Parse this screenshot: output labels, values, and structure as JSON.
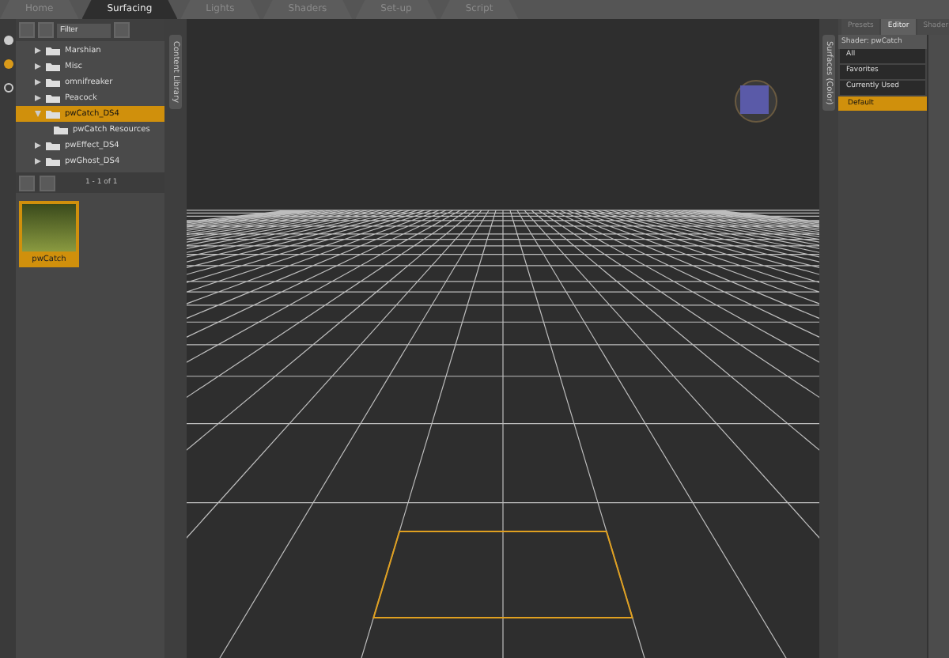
{
  "top_tabs": [
    {
      "label": "Home",
      "selected": false
    },
    {
      "label": "Surfacing",
      "selected": true
    },
    {
      "label": "Lights",
      "selected": false
    },
    {
      "label": "Shaders",
      "selected": false
    },
    {
      "label": "Set-up",
      "selected": false
    },
    {
      "label": "Script",
      "selected": false
    }
  ],
  "content_library": {
    "tab_label": "Content Library",
    "search_placeholder": "Filter",
    "tree": [
      {
        "label": "Marshian",
        "expanded": false,
        "selected": false
      },
      {
        "label": "Misc",
        "expanded": false,
        "selected": false
      },
      {
        "label": "omnifreaker",
        "expanded": false,
        "selected": false
      },
      {
        "label": "Peacock",
        "expanded": false,
        "selected": false
      },
      {
        "label": "pwCatch_DS4",
        "expanded": true,
        "selected": true,
        "children": [
          {
            "label": "pwCatch Resources",
            "expanded": false,
            "selected": false
          }
        ]
      },
      {
        "label": "pwEffect_DS4",
        "expanded": false,
        "selected": false
      },
      {
        "label": "pwGhost_DS4",
        "expanded": false,
        "selected": false
      }
    ],
    "pager": "1 - 1 of 1",
    "thumbnails": [
      {
        "label": "pwCatch",
        "selected": true
      }
    ]
  },
  "surfaces": {
    "tab_label": "Surfaces (Color)",
    "tabs": [
      {
        "label": "Presets",
        "selected": false
      },
      {
        "label": "Editor",
        "selected": true
      },
      {
        "label": "Shader",
        "selected": false
      }
    ],
    "shader_label": "Shader: pwCatch",
    "filters": [
      {
        "label": "All"
      },
      {
        "label": "Favorites"
      },
      {
        "label": "Currently Used"
      }
    ],
    "tree": [
      {
        "label": "Default",
        "selected": true
      }
    ]
  }
}
